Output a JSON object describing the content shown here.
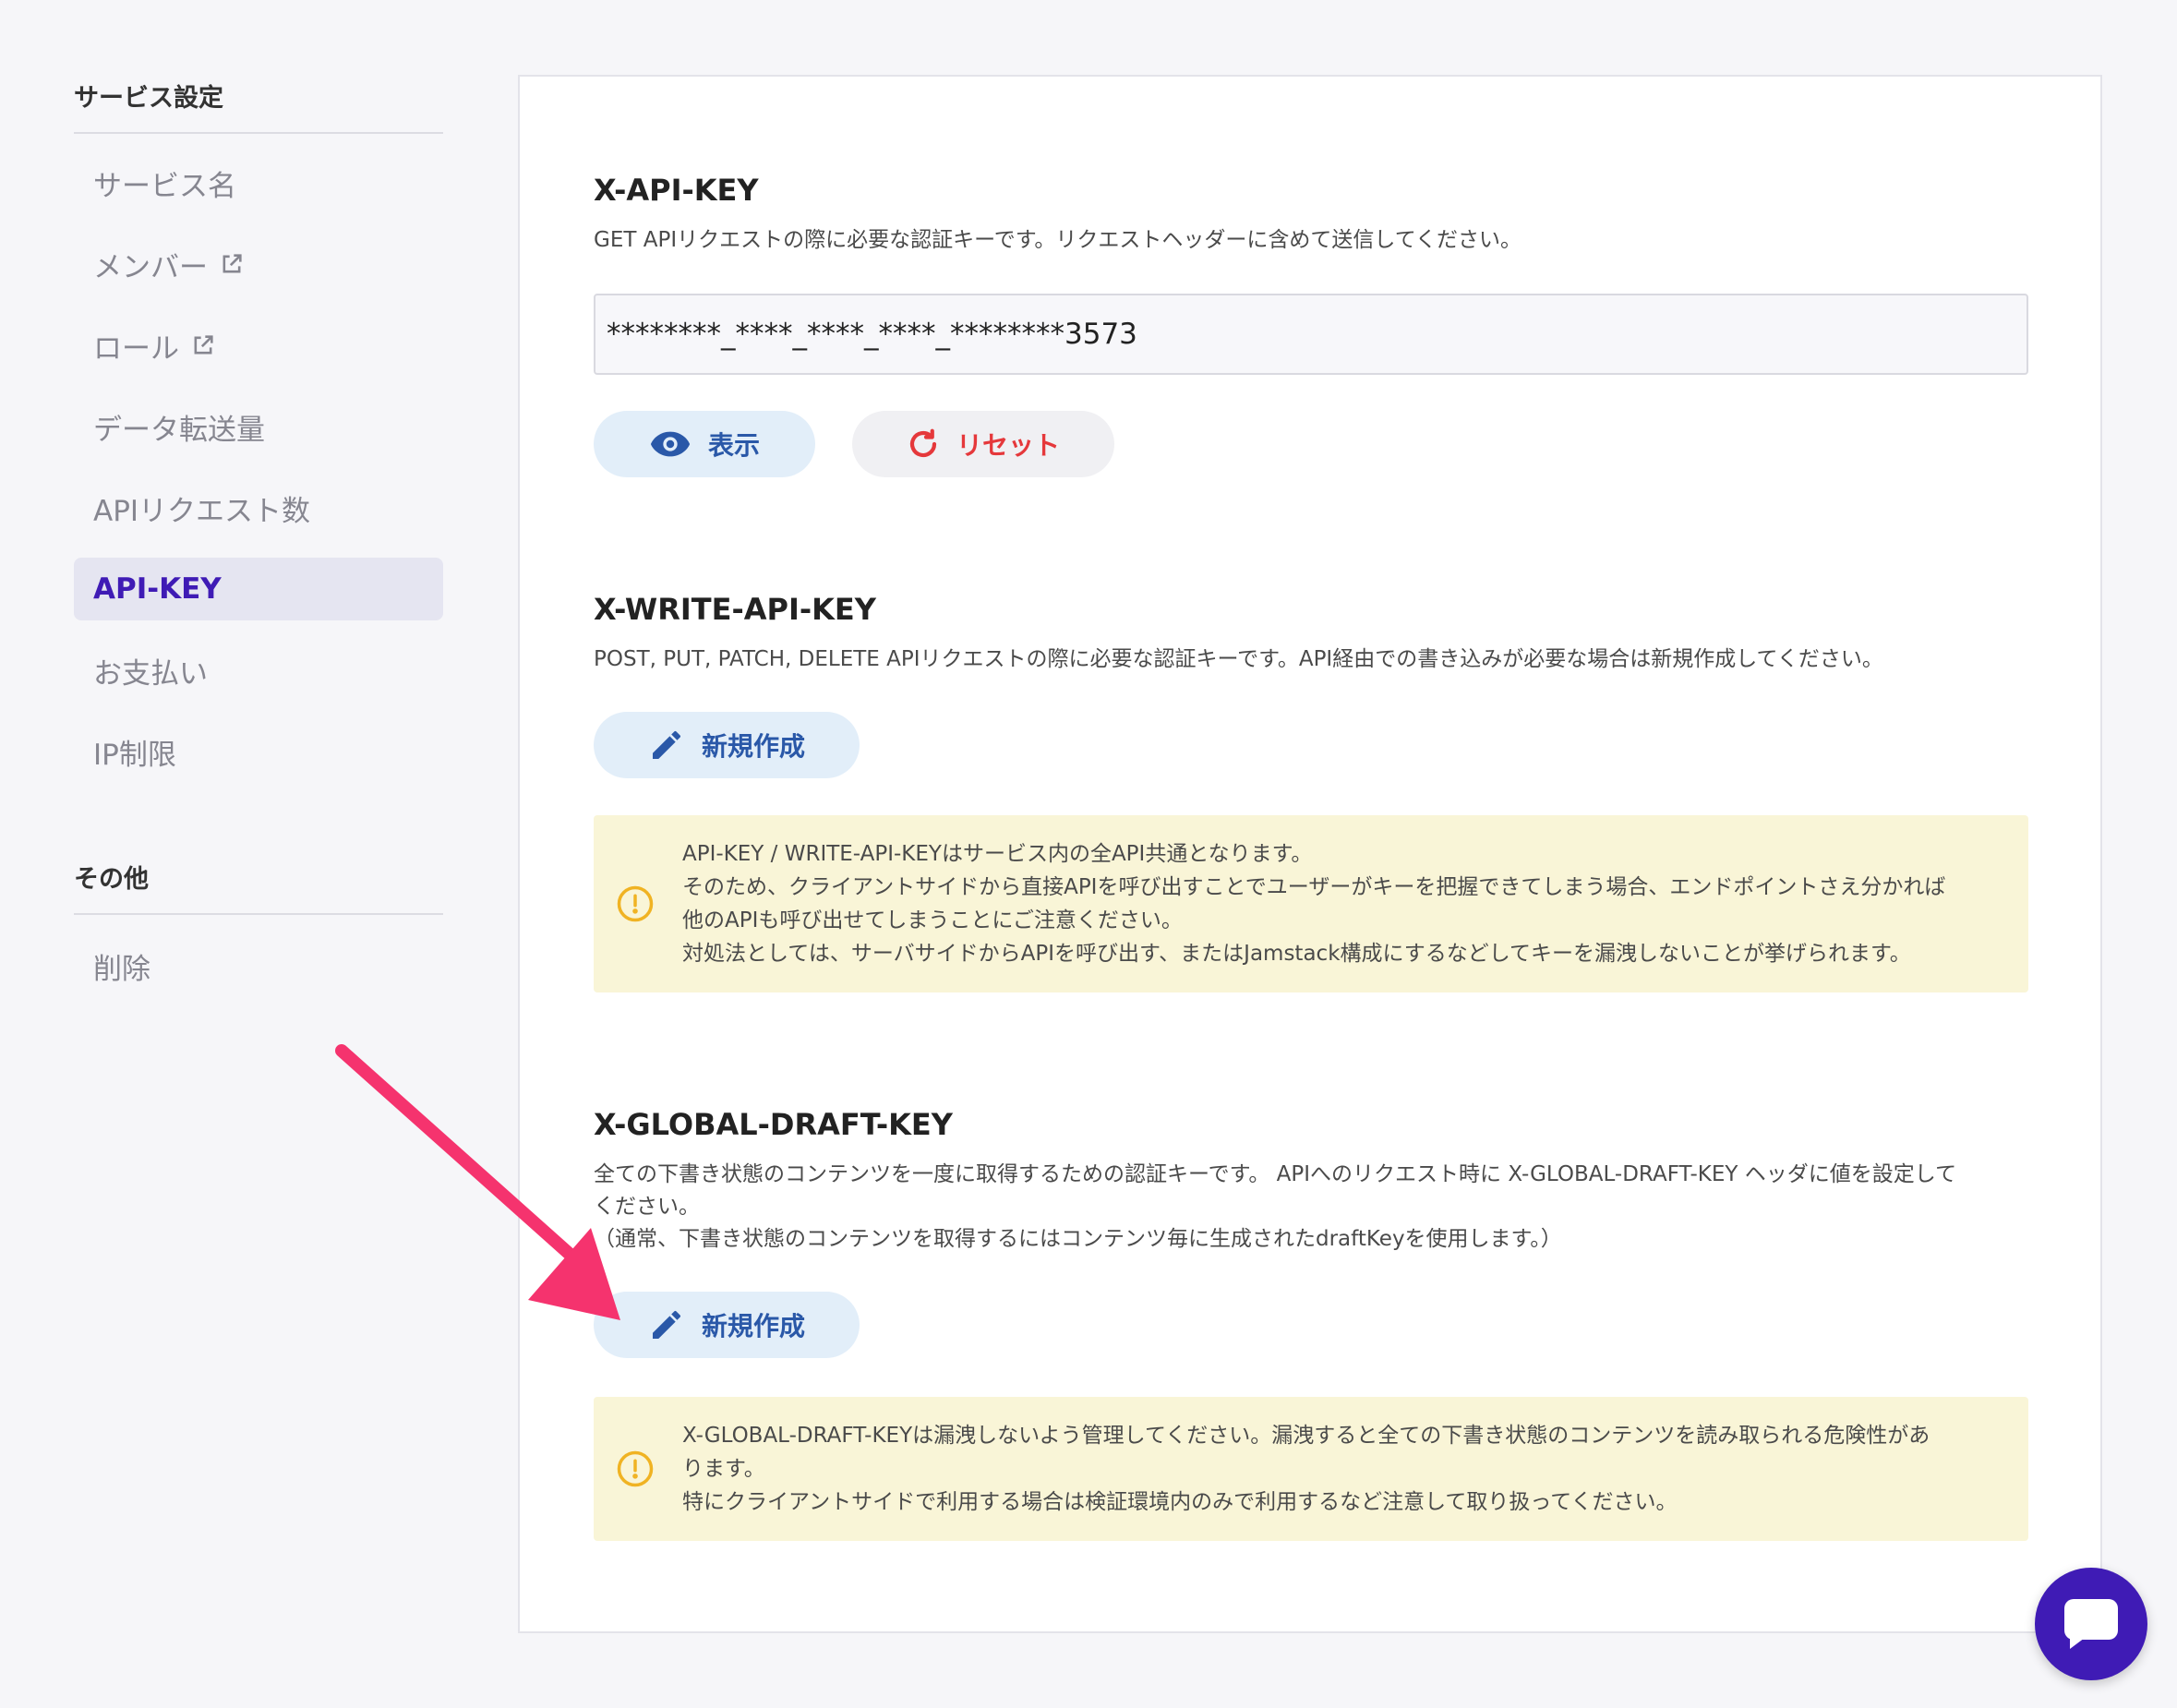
{
  "sidebar": {
    "sections": [
      {
        "title": "サービス設定",
        "items": [
          {
            "label": "サービス名",
            "external": false,
            "active": false
          },
          {
            "label": "メンバー",
            "external": true,
            "active": false
          },
          {
            "label": "ロール",
            "external": true,
            "active": false
          },
          {
            "label": "データ転送量",
            "external": false,
            "active": false
          },
          {
            "label": "APIリクエスト数",
            "external": false,
            "active": false
          },
          {
            "label": "API-KEY",
            "external": false,
            "active": true
          },
          {
            "label": "お支払い",
            "external": false,
            "active": false
          },
          {
            "label": "IP制限",
            "external": false,
            "active": false
          }
        ]
      },
      {
        "title": "その他",
        "items": [
          {
            "label": "削除",
            "external": false,
            "active": false
          }
        ]
      }
    ]
  },
  "main": {
    "api_key": {
      "title": "X-API-KEY",
      "description": "GET APIリクエストの際に必要な認証キーです。リクエストヘッダーに含めて送信してください。",
      "value": "********_****_****_****_********3573",
      "show_label": "表示",
      "reset_label": "リセット"
    },
    "write_key": {
      "title": "X-WRITE-API-KEY",
      "description": "POST, PUT, PATCH, DELETE APIリクエストの際に必要な認証キーです。API経由での書き込みが必要な場合は新規作成してください。",
      "create_label": "新規作成",
      "notice_lines": [
        "API-KEY / WRITE-API-KEYはサービス内の全API共通となります。",
        "そのため、クライアントサイドから直接APIを呼び出すことでユーザーがキーを把握できてしまう場合、エンドポイントさえ分かれば",
        "他のAPIも呼び出せてしまうことにご注意ください。",
        "対処法としては、サーバサイドからAPIを呼び出す、またはJamstack構成にするなどしてキーを漏洩しないことが挙げられます。"
      ]
    },
    "draft_key": {
      "title": "X-GLOBAL-DRAFT-KEY",
      "description_lines": [
        "全ての下書き状態のコンテンツを一度に取得するための認証キーです。 APIへのリクエスト時に X-GLOBAL-DRAFT-KEY ヘッダに値を設定して",
        "ください。",
        "（通常、下書き状態のコンテンツを取得するにはコンテンツ毎に生成されたdraftKeyを使用します。）"
      ],
      "create_label": "新規作成",
      "notice_lines": [
        "X-GLOBAL-DRAFT-KEYは漏洩しないよう管理してください。漏洩すると全ての下書き状態のコンテンツを読み取られる危険性があ",
        "ります。",
        "特にクライアントサイドで利用する場合は検証環境内のみで利用するなど注意して取り扱ってください。"
      ]
    }
  },
  "colors": {
    "accent": "#3f1bb5",
    "button_blue_bg": "#e2eef9",
    "button_blue_text": "#2a58a8",
    "reset_red": "#e5383b",
    "notice_bg": "#f9f5d7",
    "warning_icon": "#f0b323",
    "arrow": "#f5336e"
  },
  "icons": {
    "show": "eye-icon",
    "reset": "refresh-icon",
    "create": "pencil-icon",
    "notice": "exclamation-circle-icon",
    "external": "external-link-icon",
    "chat": "chat-bubble-icon"
  }
}
